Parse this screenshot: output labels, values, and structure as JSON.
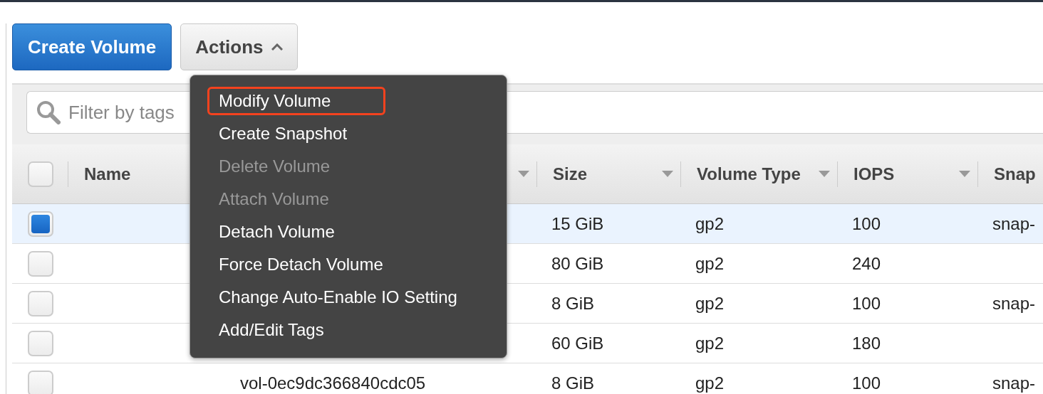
{
  "toolbar": {
    "create_button": "Create Volume",
    "actions_button": {
      "label": "Actions",
      "expanded": true
    }
  },
  "actions_menu": [
    {
      "label": "Modify Volume",
      "disabled": false,
      "highlighted": true
    },
    {
      "label": "Create Snapshot",
      "disabled": false,
      "highlighted": false
    },
    {
      "label": "Delete Volume",
      "disabled": true,
      "highlighted": false
    },
    {
      "label": "Attach Volume",
      "disabled": true,
      "highlighted": false
    },
    {
      "label": "Detach Volume",
      "disabled": false,
      "highlighted": false
    },
    {
      "label": "Force Detach Volume",
      "disabled": false,
      "highlighted": false
    },
    {
      "label": "Change Auto-Enable IO Setting",
      "disabled": false,
      "highlighted": false
    },
    {
      "label": "Add/Edit Tags",
      "disabled": false,
      "highlighted": false
    }
  ],
  "filter": {
    "placeholder": "Filter by tags"
  },
  "table": {
    "header_checkbox": {
      "checked": false
    },
    "columns": [
      {
        "label": "Name",
        "sort_caret": false
      },
      {
        "sort_caret": true
      },
      {
        "label": "Size",
        "sort_caret": true
      },
      {
        "label": "Volume Type",
        "sort_caret": true
      },
      {
        "label": "IOPS",
        "sort_caret": true
      },
      {
        "label": "Snap"
      }
    ],
    "rows": [
      {
        "selected": true,
        "checked": true,
        "size": "15 GiB",
        "volume_type": "gp2",
        "iops": "100",
        "snapshot": "snap-"
      },
      {
        "selected": false,
        "checked": false,
        "size": "80 GiB",
        "volume_type": "gp2",
        "iops": "240"
      },
      {
        "selected": false,
        "checked": false,
        "size": "8 GiB",
        "volume_type": "gp2",
        "iops": "100",
        "snapshot": "snap-"
      },
      {
        "selected": false,
        "checked": false,
        "size": "60 GiB",
        "volume_type": "gp2",
        "iops": "180"
      },
      {
        "selected": false,
        "checked": false,
        "volume_id": "vol-0ec9dc366840cdc05",
        "size": "8 GiB",
        "volume_type": "gp2",
        "iops": "100",
        "snapshot": "snap-"
      }
    ]
  }
}
